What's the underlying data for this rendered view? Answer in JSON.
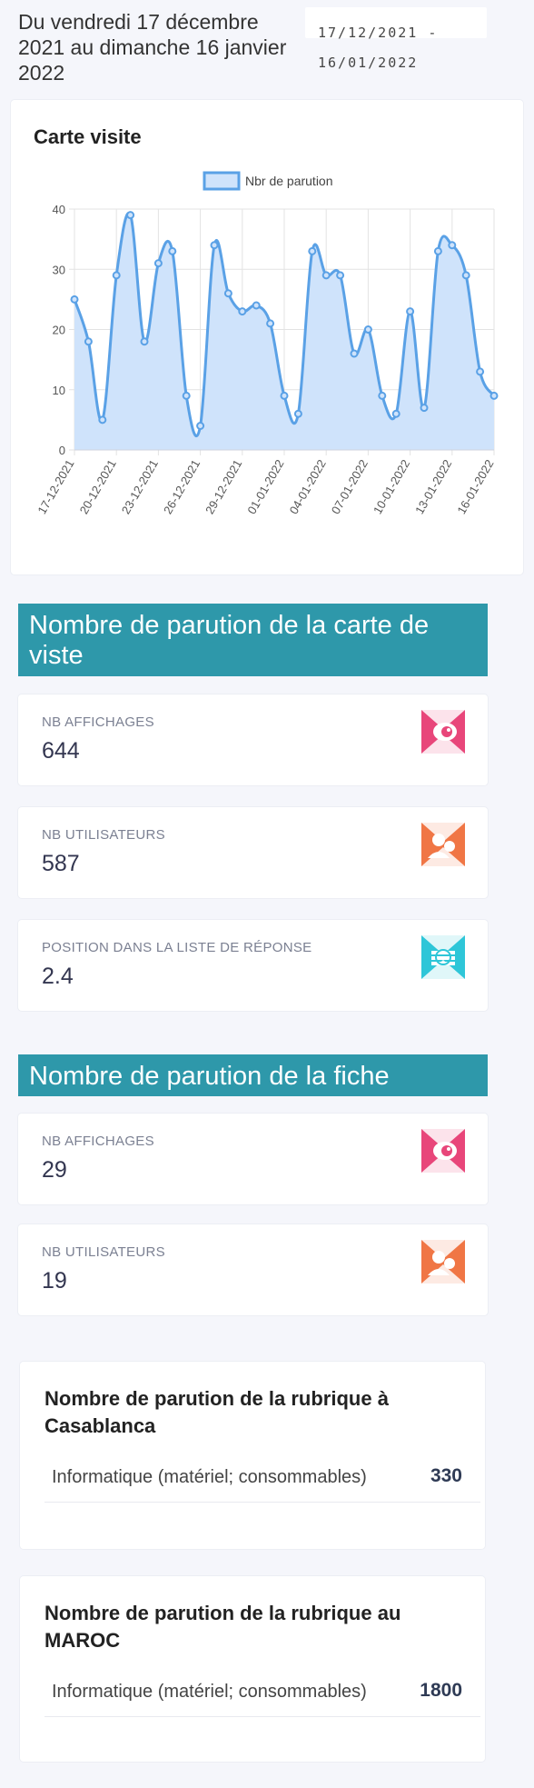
{
  "header": {
    "period_text": "Du vendredi 17 décembre 2021 au dimanche 16 janvier 2022",
    "date_range_value": "17/12/2021 - 16/01/2022"
  },
  "chart_card": {
    "title": "Carte visite"
  },
  "chart_data": {
    "type": "area",
    "title": "",
    "xlabel": "",
    "ylabel": "",
    "legend": [
      "Nbr de parution"
    ],
    "legend_position": "top",
    "grid": true,
    "ylim": [
      0,
      40
    ],
    "yticks": [
      0,
      10,
      20,
      30,
      40
    ],
    "xtick_labels": [
      "17-12-2021",
      "20-12-2021",
      "23-12-2021",
      "26-12-2021",
      "29-12-2021",
      "01-01-2022",
      "04-01-2022",
      "07-01-2022",
      "10-01-2022",
      "13-01-2022",
      "16-01-2022"
    ],
    "x": [
      "17-12-2021",
      "18-12-2021",
      "19-12-2021",
      "20-12-2021",
      "21-12-2021",
      "22-12-2021",
      "23-12-2021",
      "24-12-2021",
      "25-12-2021",
      "26-12-2021",
      "27-12-2021",
      "28-12-2021",
      "29-12-2021",
      "30-12-2021",
      "31-12-2021",
      "01-01-2022",
      "02-01-2022",
      "03-01-2022",
      "04-01-2022",
      "05-01-2022",
      "06-01-2022",
      "07-01-2022",
      "08-01-2022",
      "09-01-2022",
      "10-01-2022",
      "11-01-2022",
      "12-01-2022",
      "13-01-2022",
      "14-01-2022",
      "15-01-2022",
      "16-01-2022"
    ],
    "series": [
      {
        "name": "Nbr de parution",
        "values": [
          25,
          18,
          5,
          29,
          39,
          18,
          31,
          33,
          9,
          4,
          34,
          26,
          23,
          24,
          21,
          9,
          6,
          33,
          29,
          29,
          16,
          20,
          9,
          6,
          23,
          7,
          33,
          34,
          29,
          13,
          9
        ]
      }
    ],
    "colors": {
      "line": "#5aa1e6",
      "fill": "#cfe3fb"
    }
  },
  "sections": {
    "carte_banner": "Nombre de parution de la carte de viste",
    "fiche_banner": "Nombre de parution de la fiche"
  },
  "stats_carte": [
    {
      "label": "NB AFFICHAGES",
      "value": "644",
      "icon": "eye-icon",
      "color": "#e8467a"
    },
    {
      "label": "NB UTILISATEURS",
      "value": "587",
      "icon": "users-icon",
      "color": "#f07645"
    },
    {
      "label": "POSITION DANS LA LISTE DE RÉPONSE",
      "value": "2.4",
      "icon": "list-position-icon",
      "color": "#2ec6d8"
    }
  ],
  "stats_fiche": [
    {
      "label": "NB AFFICHAGES",
      "value": "29",
      "icon": "eye-icon",
      "color": "#e8467a"
    },
    {
      "label": "NB UTILISATEURS",
      "value": "19",
      "icon": "users-icon",
      "color": "#f07645"
    }
  ],
  "rubrique_casablanca": {
    "title": "Nombre de parution de la rubrique à Casablanca",
    "rows": [
      {
        "label": "Informatique (matériel; consommables)",
        "value": "330"
      }
    ]
  },
  "rubrique_maroc": {
    "title": "Nombre de parution de la rubrique au MAROC",
    "rows": [
      {
        "label": "Informatique (matériel; consommables)",
        "value": "1800"
      }
    ]
  }
}
